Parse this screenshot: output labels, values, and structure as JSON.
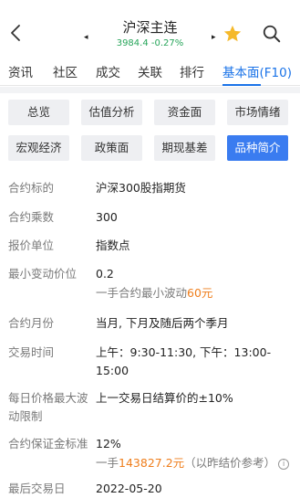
{
  "header": {
    "title": "沪深主连",
    "price": "3984.4",
    "change": "-0.27%",
    "prev_arrow": "◂",
    "next_arrow": "▸"
  },
  "tabs": [
    "资讯",
    "社区",
    "成交",
    "关联",
    "排行",
    "基本面(F10)"
  ],
  "active_tab": "基本面(F10)",
  "subnav": {
    "row1": [
      "总览",
      "估值分析",
      "资金面",
      "市场情绪"
    ],
    "row2": [
      "宏观经济",
      "政策面",
      "期现基差",
      "品种简介"
    ],
    "active": "品种简介"
  },
  "info": {
    "contract_label": "合约标的",
    "contract_value": "沪深300股指期货",
    "multiplier_label": "合约乘数",
    "multiplier_value": "300",
    "unit_label": "报价单位",
    "unit_value": "指数点",
    "tick_label": "最小变动价位",
    "tick_value": "0.2",
    "tick_sub_prefix": "一手合约最小波动",
    "tick_sub_amount": "60元",
    "month_label": "合约月份",
    "month_value": "当月, 下月及随后两个季月",
    "time_label": "交易时间",
    "time_value_line1": "上午：9:30-11:30, 下午：13:00-",
    "time_value_line2": "15:00",
    "limit_label_line1": "每日价格最大波",
    "limit_label_line2": "动限制",
    "limit_value": "上一交易日结算价的±10%",
    "margin_label": "合约保证金标准",
    "margin_value": "12%",
    "margin_sub_prefix": "一手",
    "margin_sub_amount": "143827.2元",
    "margin_sub_suffix": "（以昨结价参考）",
    "last_day_label": "最后交易日",
    "last_day_value": "2022-05-20"
  },
  "colors": {
    "accent": "#1a73e8",
    "active_button": "#3a7cf0",
    "up_down_green": "#27a55a",
    "highlight_orange": "#ef7e1c",
    "star": "#f5b92b"
  },
  "icons": [
    "back-icon",
    "star-icon",
    "search-icon",
    "info-icon"
  ]
}
